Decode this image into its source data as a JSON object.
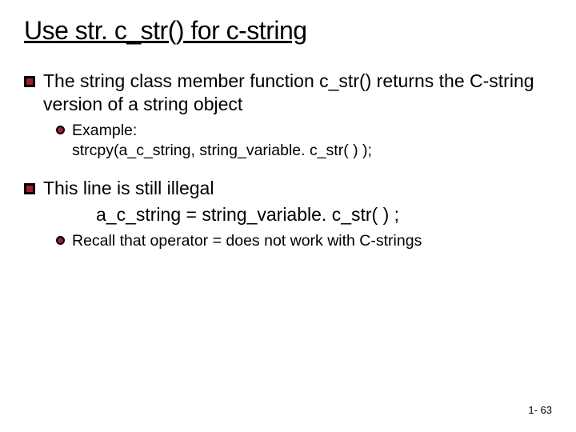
{
  "title": "Use str. c_str() for c-string",
  "bullet1": {
    "text": "The string class member function c_str() returns the C-string version of a string object",
    "sub": "Example:\nstrcpy(a_c_string, string_variable. c_str( ) );"
  },
  "bullet2": {
    "text": "This line is still illegal",
    "code": "a_c_string = string_variable. c_str( ) ;",
    "sub": "Recall that operator = does not work with C-strings"
  },
  "page": "1- 63"
}
